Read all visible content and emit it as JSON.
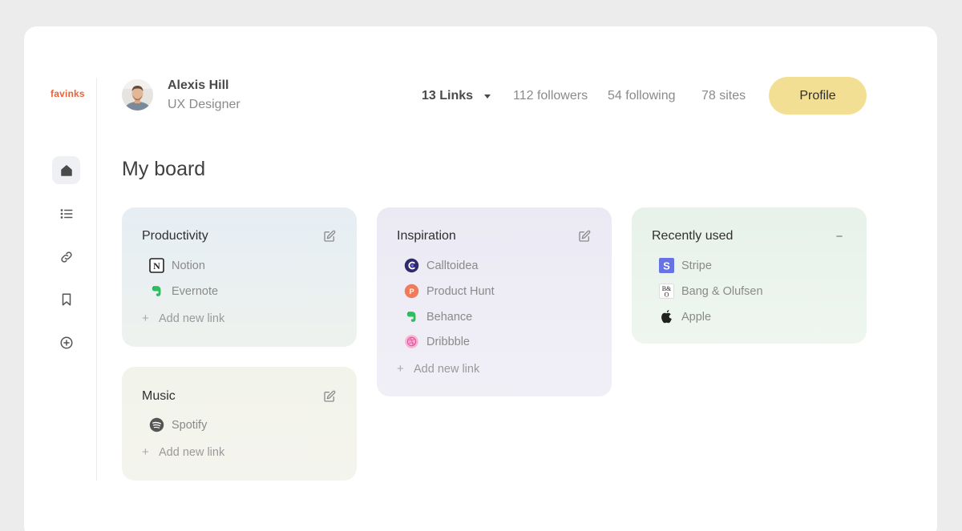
{
  "brand": {
    "logo": "favinks"
  },
  "sidebar": {
    "items": [
      {
        "icon": "home-icon",
        "active": true
      },
      {
        "icon": "list-icon",
        "active": false
      },
      {
        "icon": "link-icon",
        "active": false
      },
      {
        "icon": "bookmark-icon",
        "active": false
      },
      {
        "icon": "add-circle-icon",
        "active": false
      }
    ]
  },
  "user": {
    "name": "Alexis Hill",
    "role": "UX Designer"
  },
  "stats": {
    "links_label": "13 Links",
    "followers": "112 followers",
    "following": "54 following",
    "sites": "78 sites"
  },
  "profile_button": "Profile",
  "page_title": "My board",
  "boards": {
    "productivity": {
      "title": "Productivity",
      "links": [
        {
          "label": "Notion",
          "icon": "notion-icon"
        },
        {
          "label": "Evernote",
          "icon": "evernote-icon"
        }
      ],
      "add_label": "Add new link"
    },
    "inspiration": {
      "title": "Inspiration",
      "links": [
        {
          "label": "Calltoidea",
          "icon": "calltoidea-icon"
        },
        {
          "label": "Product Hunt",
          "icon": "product-hunt-icon"
        },
        {
          "label": "Behance",
          "icon": "behance-icon"
        },
        {
          "label": "Dribbble",
          "icon": "dribbble-icon"
        }
      ],
      "add_label": "Add new link"
    },
    "recent": {
      "title": "Recently used",
      "links": [
        {
          "label": "Stripe",
          "icon": "stripe-icon"
        },
        {
          "label": "Bang & Olufsen",
          "icon": "bang-olufsen-icon"
        },
        {
          "label": "Apple",
          "icon": "apple-icon"
        }
      ],
      "action": "−"
    },
    "music": {
      "title": "Music",
      "links": [
        {
          "label": "Spotify",
          "icon": "spotify-icon"
        }
      ],
      "add_label": "Add new link"
    }
  },
  "colors": {
    "productivity_card": "#eaf0f4",
    "inspiration_card": "#efedf5",
    "recent_card": "#eaf4ec",
    "music_card": "#f3f4ec",
    "profile_button": "#f3df93",
    "logo": "#e8643c"
  }
}
